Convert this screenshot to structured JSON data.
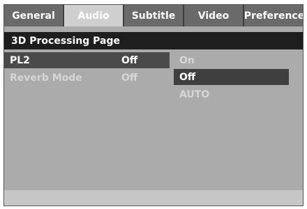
{
  "tabs": [
    {
      "label": "General",
      "active": false
    },
    {
      "label": "Audio",
      "active": true
    },
    {
      "label": "Subtitle",
      "active": false
    },
    {
      "label": "Video",
      "active": false
    },
    {
      "label": "Preference",
      "active": false
    }
  ],
  "page": {
    "title": "3D Processing Page"
  },
  "settings": [
    {
      "label": "PL2",
      "value": "Off",
      "selected": true
    },
    {
      "label": "Reverb Mode",
      "value": "Off",
      "selected": false
    }
  ],
  "options": [
    {
      "label": "On",
      "selected": false
    },
    {
      "label": "Off",
      "selected": true
    },
    {
      "label": "AUTO",
      "selected": false
    }
  ]
}
